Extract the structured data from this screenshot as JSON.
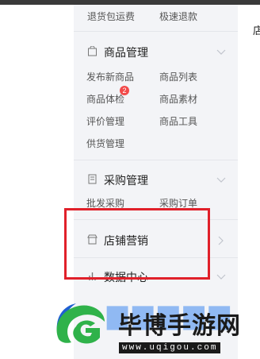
{
  "sidebar": {
    "top_links": [
      "退货包运费",
      "极速退款"
    ],
    "groups": [
      {
        "title": "商品管理",
        "icon": "bag-icon",
        "items": [
          "发布新商品",
          "商品列表",
          "商品体检",
          "商品素材",
          "评价管理",
          "商品工具",
          "供货管理"
        ],
        "badge": "2"
      },
      {
        "title": "采购管理",
        "icon": "document-icon",
        "items": [
          "批发采购",
          "采购订单"
        ]
      },
      {
        "title": "店铺营销",
        "icon": "shop-icon",
        "items": []
      },
      {
        "title": "数据中心",
        "icon": "bar-chart-icon",
        "items": []
      }
    ]
  },
  "right_pane_char": "店",
  "watermark": {
    "name": "毕博手游网",
    "url": "www.uqigou.com"
  },
  "colors": {
    "sidebar_bg": "#f3f4f7",
    "highlight": "#e0202a",
    "badge": "#f24a4a",
    "logo_green": "#2fb24a",
    "watermark_blue": "#6fa6f2"
  }
}
